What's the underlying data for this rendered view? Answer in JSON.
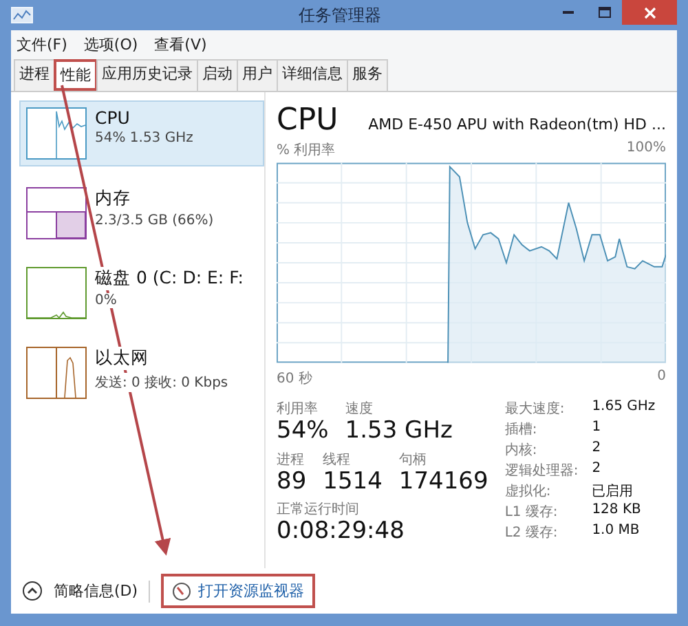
{
  "window": {
    "title": "任务管理器"
  },
  "menu": [
    "文件(F)",
    "选项(O)",
    "查看(V)"
  ],
  "tabs": [
    {
      "label": "进程",
      "selected": false,
      "highlighted": false
    },
    {
      "label": "性能",
      "selected": true,
      "highlighted": true
    },
    {
      "label": "应用历史记录",
      "selected": false,
      "highlighted": false
    },
    {
      "label": "启动",
      "selected": false,
      "highlighted": false
    },
    {
      "label": "用户",
      "selected": false,
      "highlighted": false
    },
    {
      "label": "详细信息",
      "selected": false,
      "highlighted": false
    },
    {
      "label": "服务",
      "selected": false,
      "highlighted": false
    }
  ],
  "sidebar": {
    "items": [
      {
        "kind": "cpu",
        "title": "CPU",
        "detail": "54% 1.53 GHz",
        "color": "#4a9ac4",
        "selected": true
      },
      {
        "kind": "memory",
        "title": "内存",
        "detail": "2.3/3.5 GB (66%)",
        "color": "#8b3fa0",
        "selected": false
      },
      {
        "kind": "disk",
        "title": "磁盘 0 (C: D: E: F:",
        "detail": "0%",
        "color": "#5f9a2e",
        "selected": false
      },
      {
        "kind": "network",
        "title": "以太网",
        "detail": "发送: 0 接收: 0 Kbps",
        "color": "#a7652a",
        "selected": false
      }
    ]
  },
  "detail": {
    "title": "CPU",
    "subtitle": "AMD E-450 APU with Radeon(tm) HD ...",
    "graph_label": "% 利用率",
    "graph_max": "100%",
    "graph_start": "60 秒",
    "graph_end": "0",
    "stats": [
      [
        {
          "label": "利用率",
          "value": "54%"
        },
        {
          "label": "速度",
          "value": "1.53 GHz"
        }
      ],
      [
        {
          "label": "进程",
          "value": "89"
        },
        {
          "label": "线程",
          "value": "1514"
        },
        {
          "label": "句柄",
          "value": "174169"
        }
      ],
      [
        {
          "label": "正常运行时间",
          "value": "0:08:29:48"
        }
      ]
    ],
    "specs": [
      {
        "label": "最大速度:",
        "value": "1.65 GHz"
      },
      {
        "label": "插槽:",
        "value": "1"
      },
      {
        "label": "内核:",
        "value": "2"
      },
      {
        "label": "逻辑处理器:",
        "value": "2"
      },
      {
        "label": "虚拟化:",
        "value": "已启用"
      },
      {
        "label": "L1 缓存:",
        "value": "128 KB"
      },
      {
        "label": "L2 缓存:",
        "value": "1.0 MB"
      }
    ]
  },
  "footer": {
    "fewer_details": "简略信息(D)",
    "resource_monitor": {
      "label": "打开资源监视器",
      "highlighted": true
    }
  }
}
